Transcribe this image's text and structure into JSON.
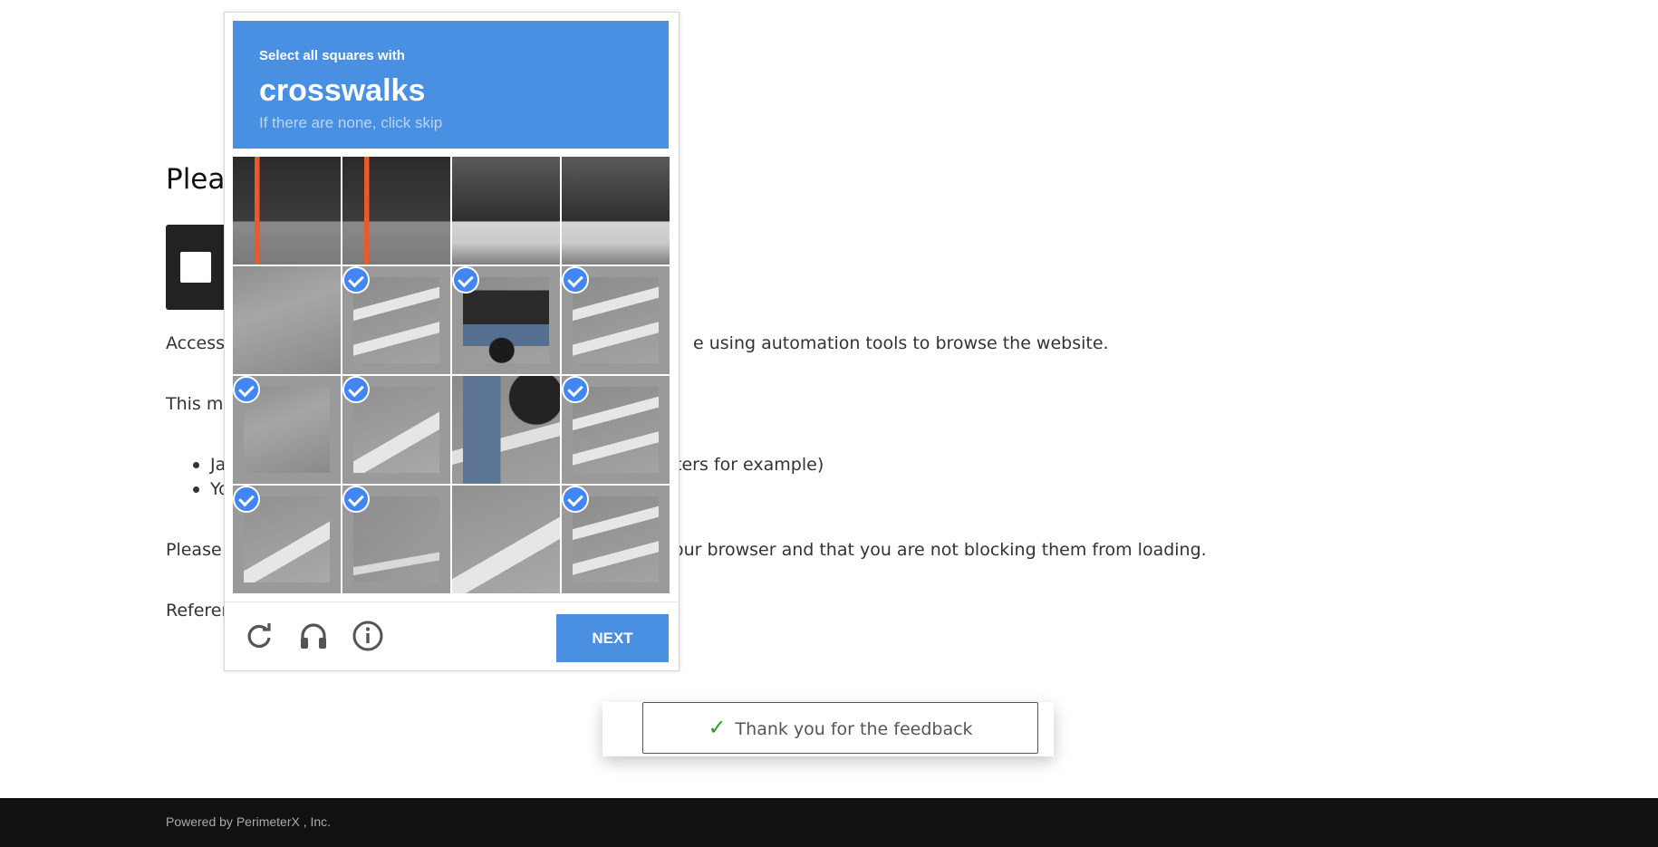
{
  "page": {
    "heading": "Pleas",
    "lines": [
      {
        "left": "Access",
        "right": "e using automation tools to browse the website."
      },
      {
        "left": "This ma",
        "right": ""
      },
      {
        "left": "Please",
        "right": "our browser and that you are not blocking them from loading."
      },
      {
        "left": "Referen",
        "right": ""
      }
    ],
    "bullets": [
      {
        "left": "Ja",
        "right": "ters for example)"
      },
      {
        "left": "Yo",
        "right": ""
      }
    ]
  },
  "captcha": {
    "instruction": "Select all squares with",
    "object": "crosswalks",
    "hint": "If there are none, click skip",
    "tiles": [
      {
        "id": 1,
        "selected": false,
        "texture": "site"
      },
      {
        "id": 2,
        "selected": false,
        "texture": "site"
      },
      {
        "id": 3,
        "selected": false,
        "texture": "site2"
      },
      {
        "id": 4,
        "selected": false,
        "texture": "site2"
      },
      {
        "id": 5,
        "selected": false,
        "texture": "road"
      },
      {
        "id": 6,
        "selected": true,
        "texture": "stripes"
      },
      {
        "id": 7,
        "selected": true,
        "texture": "moto"
      },
      {
        "id": 8,
        "selected": true,
        "texture": "stripes"
      },
      {
        "id": 9,
        "selected": true,
        "texture": "road"
      },
      {
        "id": 10,
        "selected": true,
        "texture": "stripes2"
      },
      {
        "id": 11,
        "selected": false,
        "texture": "moto2"
      },
      {
        "id": 12,
        "selected": true,
        "texture": "stripes"
      },
      {
        "id": 13,
        "selected": true,
        "texture": "stripes2"
      },
      {
        "id": 14,
        "selected": true,
        "texture": "cracked"
      },
      {
        "id": 15,
        "selected": false,
        "texture": "stripes2"
      },
      {
        "id": 16,
        "selected": true,
        "texture": "stripes"
      }
    ],
    "icons": [
      "reload-icon",
      "audio-icon",
      "info-icon"
    ],
    "next_label": "NEXT",
    "accent_color": "#4a90e2"
  },
  "toast": {
    "icon": "checkmark-icon",
    "message": "Thank you for the feedback"
  },
  "footer": {
    "text": "Powered by PerimeterX , Inc."
  }
}
